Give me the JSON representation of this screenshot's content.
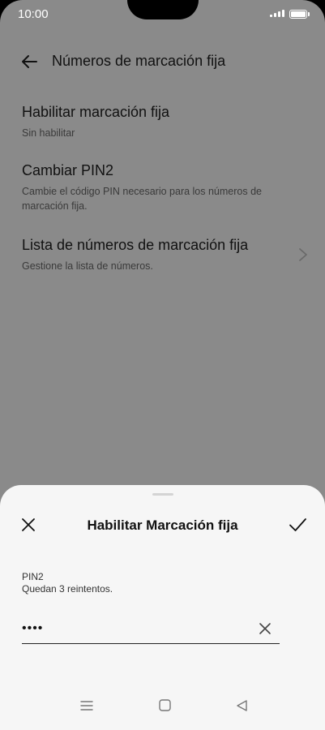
{
  "status": {
    "time": "10:00"
  },
  "appbar": {
    "title": "Números de marcación fija",
    "back_icon": "arrow-left-icon"
  },
  "settings": [
    {
      "title": "Habilitar marcación fija",
      "subtitle": "Sin habilitar"
    },
    {
      "title": "Cambiar PIN2",
      "subtitle": "Cambie el código PIN necesario para los números de marcación fija."
    },
    {
      "title": "Lista de números de marcación fija",
      "subtitle": "Gestione la lista de números.",
      "icon": "chevron-right-icon"
    }
  ],
  "sheet": {
    "title": "Habilitar Marcación fija",
    "pin_label": "PIN2",
    "retries": "Quedan 3 reintentos.",
    "pin_value": "••••"
  },
  "colors": {
    "overlay_bg": "#8a8a8a",
    "sheet_bg": "#f6f6f6"
  }
}
